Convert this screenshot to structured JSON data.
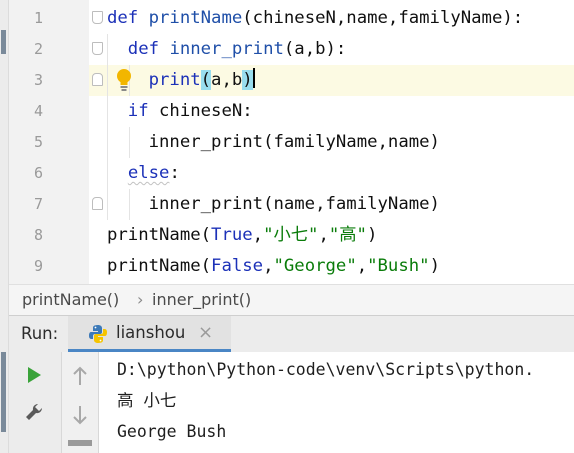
{
  "editor": {
    "line_numbers": [
      "1",
      "2",
      "3",
      "4",
      "5",
      "6",
      "7",
      "8",
      "9"
    ],
    "lines": [
      [
        {
          "t": "def ",
          "c": "kw"
        },
        {
          "t": "printName",
          "c": "fn"
        },
        {
          "t": "(chineseN,name,familyName):",
          "c": ""
        }
      ],
      [
        {
          "t": "  def ",
          "c": "kw"
        },
        {
          "t": "inner_print",
          "c": "fn"
        },
        {
          "t": "(a,b):",
          "c": ""
        }
      ],
      [
        {
          "t": "    print",
          "c": "bi"
        },
        {
          "t": "(",
          "c": "paren"
        },
        {
          "t": "a,b",
          "c": ""
        },
        {
          "t": ")",
          "c": "paren"
        },
        {
          "t": "",
          "c": "caret"
        }
      ],
      [
        {
          "t": "  if ",
          "c": "kw"
        },
        {
          "t": "chineseN:",
          "c": ""
        }
      ],
      [
        {
          "t": "    inner_print(familyName,name)",
          "c": ""
        }
      ],
      [
        {
          "t": "  ",
          "c": ""
        },
        {
          "t": "else",
          "c": "kw-wavy"
        },
        {
          "t": ":",
          "c": ""
        }
      ],
      [
        {
          "t": "    inner_print(name,familyName)",
          "c": ""
        }
      ],
      [
        {
          "t": "printName(",
          "c": ""
        },
        {
          "t": "True",
          "c": "kw"
        },
        {
          "t": ",",
          "c": ""
        },
        {
          "t": "\"小七\"",
          "c": "str"
        },
        {
          "t": ",",
          "c": ""
        },
        {
          "t": "\"高\"",
          "c": "str"
        },
        {
          "t": ")",
          "c": ""
        }
      ],
      [
        {
          "t": "printName(",
          "c": ""
        },
        {
          "t": "False",
          "c": "kw"
        },
        {
          "t": ",",
          "c": ""
        },
        {
          "t": "\"George\"",
          "c": "str"
        },
        {
          "t": ",",
          "c": ""
        },
        {
          "t": "\"Bush\"",
          "c": "str"
        },
        {
          "t": ")",
          "c": ""
        }
      ]
    ]
  },
  "breadcrumb": {
    "item1": "printName()",
    "separator": "›",
    "item2": "inner_print()"
  },
  "run_panel": {
    "label": "Run:",
    "tab_name": "lianshou",
    "tab_close": "×",
    "console": [
      "D:\\python\\Python-code\\venv\\Scripts\\python.",
      "高 小七",
      "George Bush"
    ]
  },
  "colors": {
    "keyword": "#1c31b8",
    "string": "#0a7c0a",
    "current_line": "#fcfae3",
    "run_green": "#3aa33a"
  },
  "icons": [
    "lightbulb-icon",
    "fold-icon",
    "python-icon",
    "run-icon",
    "wrench-icon",
    "arrow-up-icon",
    "arrow-down-icon",
    "close-icon"
  ]
}
